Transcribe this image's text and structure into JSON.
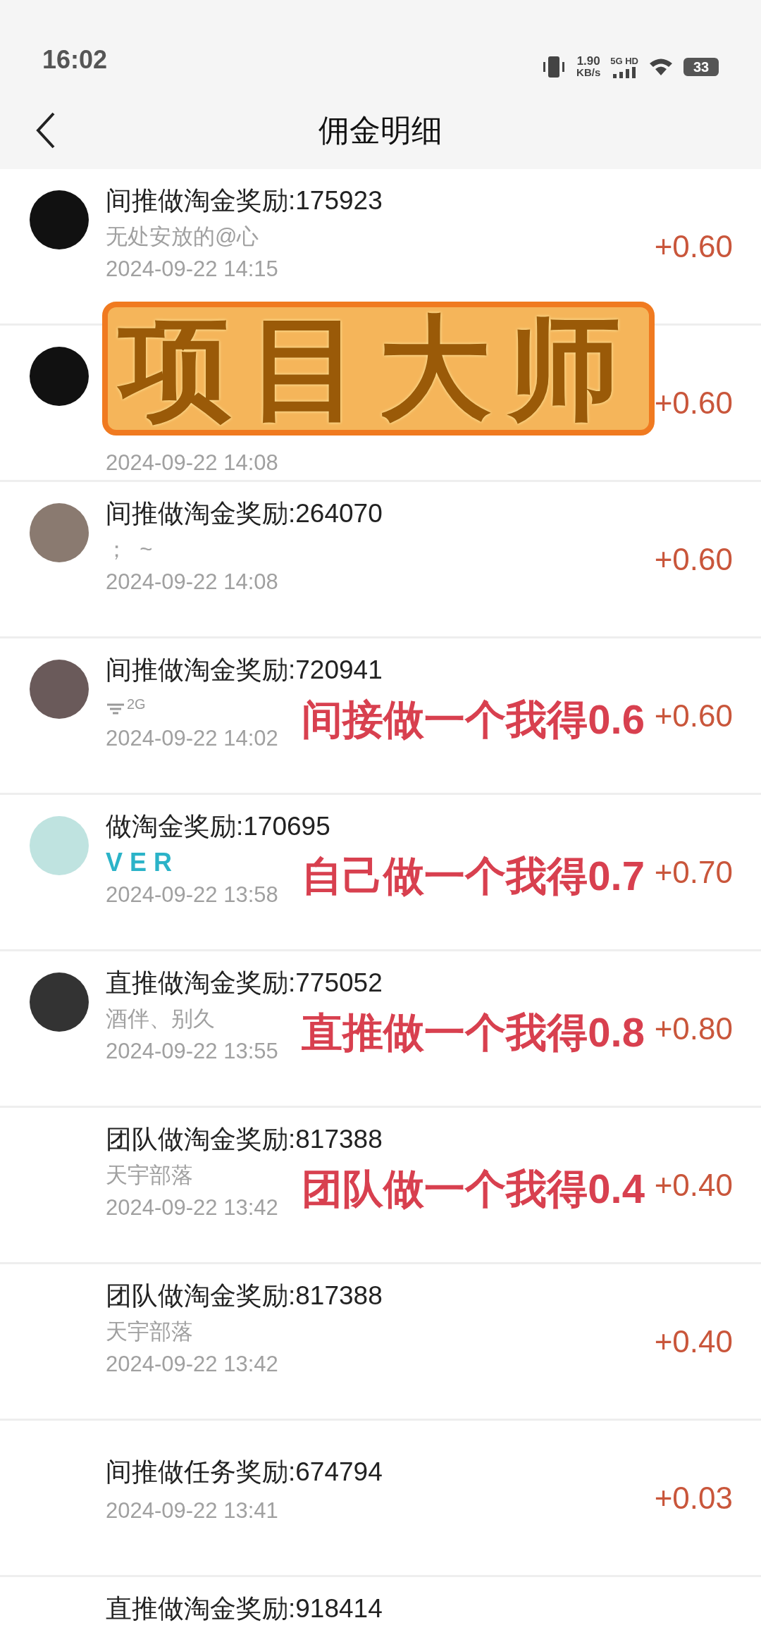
{
  "status_bar": {
    "time": "16:02",
    "net_speed": "1.90",
    "net_unit": "KB/s",
    "network": "5G HD",
    "battery": "33"
  },
  "header": {
    "title": "佣金明细"
  },
  "banner": "项目大师",
  "records": [
    {
      "avatar": true,
      "title": "间推做淘金奖励:175923",
      "subtitle": "无处安放的@心",
      "time": "2024-09-22 14:15",
      "amount": "+0.60"
    },
    {
      "avatar": true,
      "time": "2024-09-22 14:08",
      "amount": "+0.60"
    },
    {
      "avatar": true,
      "title": "间推做淘金奖励:264070",
      "subtitle": "；  ~",
      "time": "2024-09-22 14:08",
      "amount": "+0.60"
    },
    {
      "avatar": true,
      "title": "间推做淘金奖励:720941",
      "subtitle": "2G",
      "kind": "signal",
      "time": "2024-09-22 14:02",
      "amount": "+0.60",
      "annotation": "间接做一个我得0.6"
    },
    {
      "avatar": true,
      "title": "做淘金奖励:170695",
      "subtitle": "V E R",
      "kind": "brand",
      "time": "2024-09-22 13:58",
      "amount": "+0.70",
      "annotation": "自己做一个我得0.7"
    },
    {
      "avatar": true,
      "title": "直推做淘金奖励:775052",
      "subtitle": "酒伴、别久",
      "time": "2024-09-22 13:55",
      "amount": "+0.80",
      "annotation": "直推做一个我得0.8"
    },
    {
      "avatar": false,
      "title": "团队做淘金奖励:817388",
      "subtitle": "天宇部落",
      "time": "2024-09-22 13:42",
      "amount": "+0.40",
      "annotation": "团队做一个我得0.4"
    },
    {
      "avatar": false,
      "title": "团队做淘金奖励:817388",
      "subtitle": "天宇部落",
      "time": "2024-09-22 13:42",
      "amount": "+0.40"
    },
    {
      "avatar": false,
      "title": "间推做任务奖励:674794",
      "time": "2024-09-22 13:41",
      "amount": "+0.03"
    },
    {
      "avatar": false,
      "title": "直推做淘金奖励:918414"
    }
  ]
}
